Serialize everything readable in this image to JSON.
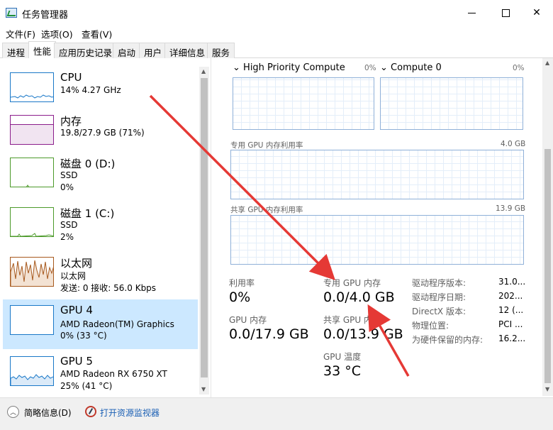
{
  "window": {
    "title": "任务管理器"
  },
  "menu": {
    "file": "文件(F)",
    "options": "选项(O)",
    "view": "查看(V)"
  },
  "tabs": [
    "进程",
    "性能",
    "应用历史记录",
    "启动",
    "用户",
    "详细信息",
    "服务"
  ],
  "resources": [
    {
      "title": "CPU",
      "line1": "14%  4.27 GHz",
      "line2": ""
    },
    {
      "title": "内存",
      "line1": "19.8/27.9 GB (71%)",
      "line2": ""
    },
    {
      "title": "磁盘 0 (D:)",
      "line1": "SSD",
      "line2": "0%"
    },
    {
      "title": "磁盘 1 (C:)",
      "line1": "SSD",
      "line2": "2%"
    },
    {
      "title": "以太网",
      "line1": "以太网",
      "line2": "发送: 0  接收: 56.0 Kbps"
    },
    {
      "title": "GPU 4",
      "line1": "AMD Radeon(TM) Graphics",
      "line2": "0% (33 °C)"
    },
    {
      "title": "GPU 5",
      "line1": "AMD Radeon RX 6750 XT",
      "line2": "25% (41 °C)"
    }
  ],
  "colors": {
    "cpu": "#1a78c8",
    "memory": "#8b1d8b",
    "disk": "#4c9a2a",
    "ethernet": "#a7591e",
    "gpu": "#1a78c8",
    "selected": "#cce8ff",
    "annotation": "#e53935"
  },
  "gpu_panel": {
    "engine1_name": "High Priority Compute",
    "engine1_pct": "0%",
    "engine2_name": "Compute 0",
    "engine2_pct": "0%",
    "dedicated_label": "专用 GPU 内存利用率",
    "dedicated_max": "4.0 GB",
    "shared_label": "共享 GPU 内存利用率",
    "shared_max": "13.9 GB",
    "util_label": "利用率",
    "util_value": "0%",
    "dedicated_mem_label": "专用 GPU 内存",
    "dedicated_mem_value": "0.0/4.0 GB",
    "gpu_mem_label": "GPU 内存",
    "gpu_mem_value": "0.0/17.9 GB",
    "shared_mem_label": "共享 GPU 内存",
    "shared_mem_value": "0.0/13.9 GB",
    "temp_label": "GPU 温度",
    "temp_value": "33 °C",
    "props": [
      {
        "label": "驱动程序版本:",
        "value": "31.0..."
      },
      {
        "label": "驱动程序日期:",
        "value": "202..."
      },
      {
        "label": "DirectX 版本:",
        "value": "12 (..."
      },
      {
        "label": "物理位置:",
        "value": "PCI ..."
      },
      {
        "label": "为硬件保留的内存:",
        "value": "16.2..."
      }
    ]
  },
  "footer": {
    "fewer_details": "简略信息(D)",
    "open_monitor": "打开资源监视器"
  }
}
